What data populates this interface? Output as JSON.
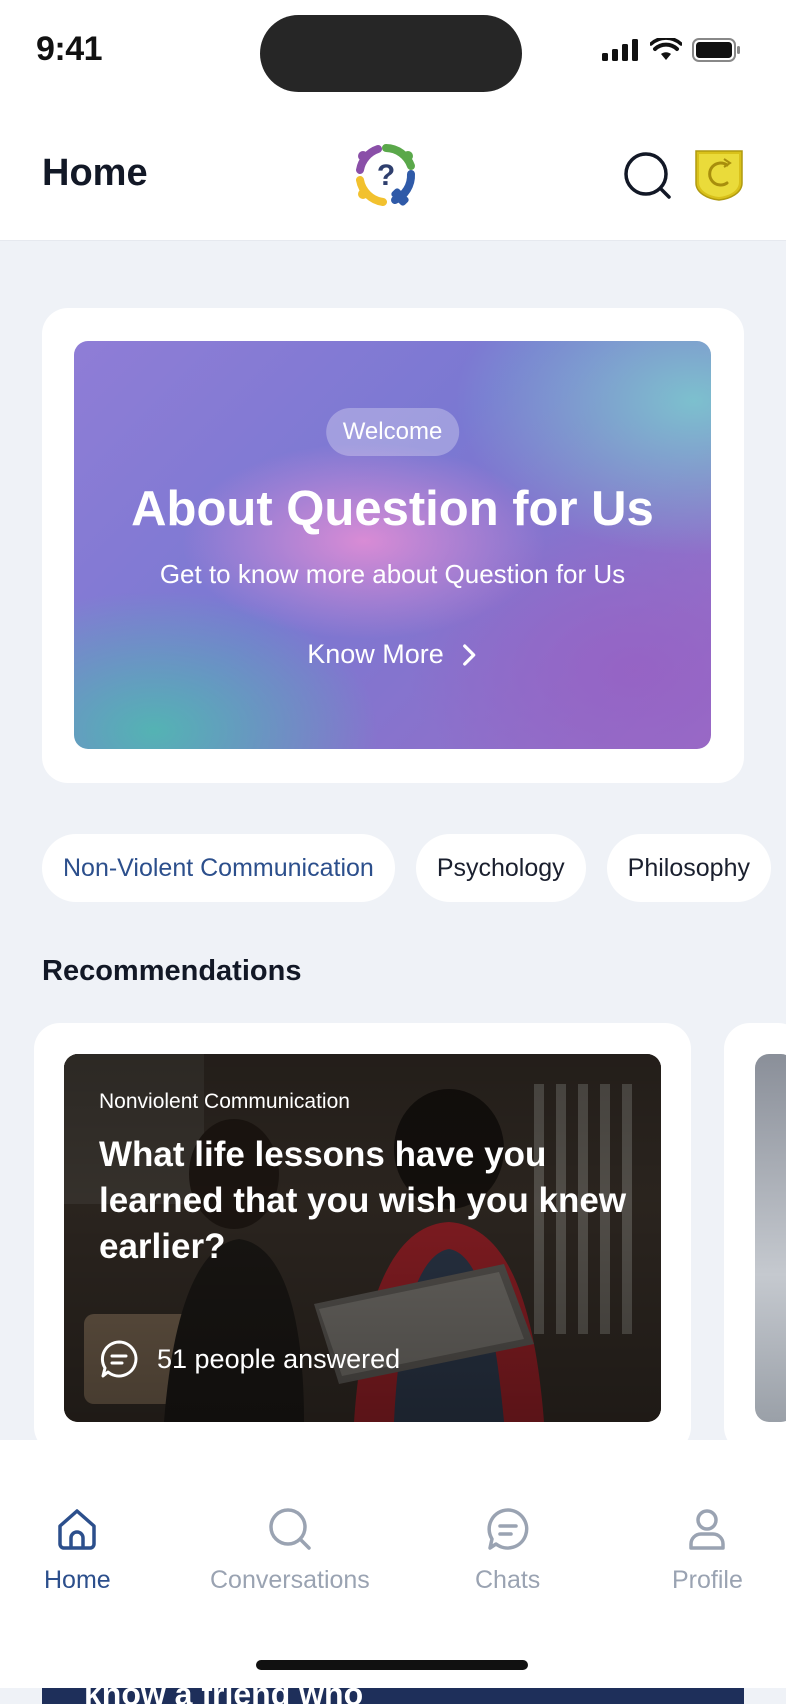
{
  "status_bar": {
    "time": "9:41"
  },
  "header": {
    "title": "Home",
    "logo_icon": "question-mark-logo-icon",
    "search_icon": "search-icon",
    "badge_icon": "org-shield-icon"
  },
  "hero": {
    "pill": "Welcome",
    "title": "About Question for Us",
    "subtitle": "Get to know more about Question for Us",
    "cta": "Know More",
    "cta_icon": "chevron-right-icon"
  },
  "chips": [
    {
      "label": "Non-Violent Communication",
      "active": true
    },
    {
      "label": "Psychology",
      "active": false
    },
    {
      "label": "Philosophy",
      "active": false
    }
  ],
  "recommendations": {
    "title": "Recommendations",
    "cards": [
      {
        "category": "Nonviolent Communication",
        "question": "What life lessons have you learned that you wish you knew earlier?",
        "answers": "51 people answered",
        "answers_icon": "chat-bubble-icon"
      }
    ]
  },
  "peek_text": "know a friend who",
  "tabs": [
    {
      "label": "Home",
      "icon": "home-icon",
      "active": true
    },
    {
      "label": "Conversations",
      "icon": "search-icon",
      "active": false
    },
    {
      "label": "Chats",
      "icon": "chat-bubble-icon",
      "active": false
    },
    {
      "label": "Profile",
      "icon": "user-icon",
      "active": false
    }
  ],
  "colors": {
    "accent": "#2c4f8c",
    "inactive": "#9aa3b2",
    "background": "#eff2f7"
  }
}
